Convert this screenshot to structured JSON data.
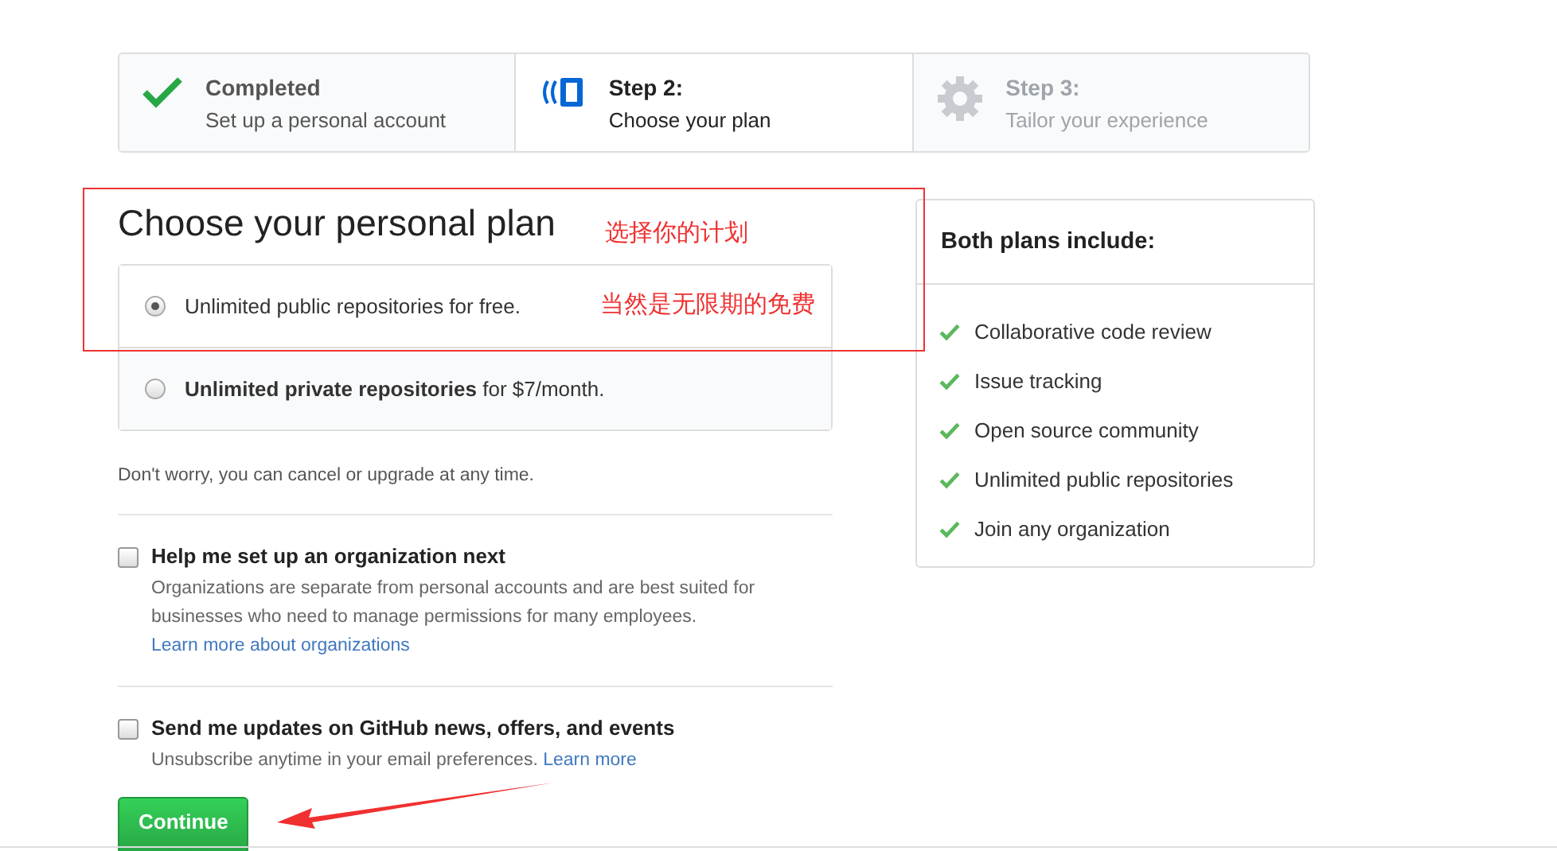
{
  "steps": [
    {
      "completed": true,
      "current": false,
      "title": "Completed",
      "subtitle": "Set up a personal account"
    },
    {
      "completed": false,
      "current": true,
      "title": "Step 2:",
      "subtitle": "Choose your plan"
    },
    {
      "completed": false,
      "current": false,
      "title": "Step 3:",
      "subtitle": "Tailor your experience"
    }
  ],
  "plan_title": "Choose your personal plan",
  "plans": [
    {
      "label": "Unlimited public repositories for free.",
      "selected": true
    },
    {
      "label": "**Unlimited private repositories** for $7/month.",
      "selected": false
    }
  ],
  "note": "Don't worry, you can cancel or upgrade at any time.",
  "options": [
    {
      "title": "Help me set up an organization next",
      "description": "Organizations are separate from personal accounts and are best suited for businesses who need to manage permissions for many employees.",
      "link": "Learn more about organizations",
      "link_block": true,
      "checked": false
    },
    {
      "title": "Send me updates on GitHub news, offers, and events",
      "description": "Unsubscribe anytime in your email preferences.",
      "link": "Learn more",
      "link_block": false,
      "checked": false
    }
  ],
  "continue_button": "Continue",
  "sidebar": {
    "title": "Both plans include:",
    "items": [
      "Collaborative code review",
      "Issue tracking",
      "Open source community",
      "Unlimited public repositories",
      "Join any organization"
    ]
  },
  "annotations": [
    "选择你的计划",
    "当然是无限期的免费"
  ]
}
